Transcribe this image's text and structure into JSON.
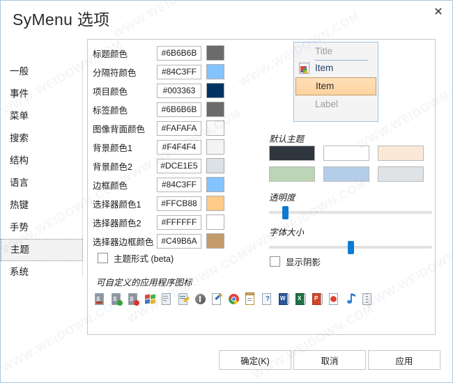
{
  "window": {
    "title": "SyMenu 选项",
    "close_icon": "close-icon"
  },
  "sidebar": {
    "items": [
      {
        "label": "一般",
        "selected": false
      },
      {
        "label": "事件",
        "selected": false
      },
      {
        "label": "菜单",
        "selected": false
      },
      {
        "label": "搜索",
        "selected": false
      },
      {
        "label": "结构",
        "selected": false
      },
      {
        "label": "语言",
        "selected": false
      },
      {
        "label": "热键",
        "selected": false
      },
      {
        "label": "手势",
        "selected": false
      },
      {
        "label": "主题",
        "selected": true
      },
      {
        "label": "系统",
        "selected": false
      }
    ]
  },
  "colors": {
    "rows": [
      {
        "label": "标题颜色",
        "value": "#6B6B6B",
        "swatch": "#6B6B6B"
      },
      {
        "label": "分隔符颜色",
        "value": "#84C3FF",
        "swatch": "#84C3FF"
      },
      {
        "label": "项目颜色",
        "value": "#003363",
        "swatch": "#003363"
      },
      {
        "label": "标签颜色",
        "value": "#6B6B6B",
        "swatch": "#6B6B6B"
      },
      {
        "label": "图像背面颜色",
        "value": "#FAFAFA",
        "swatch": "#FAFAFA"
      },
      {
        "label": "背景颜色1",
        "value": "#F4F4F4",
        "swatch": "#F4F4F4"
      },
      {
        "label": "背景颜色2",
        "value": "#DCE1E5",
        "swatch": "#DCE1E5"
      },
      {
        "label": "边框颜色",
        "value": "#84C3FF",
        "swatch": "#84C3FF"
      },
      {
        "label": "选择器颜色1",
        "value": "#FFCB88",
        "swatch": "#FFCB88"
      },
      {
        "label": "选择器颜色2",
        "value": "#FFFFFF",
        "swatch": "#FFFFFF"
      },
      {
        "label": "选择器边框颜色",
        "value": "#C49B6A",
        "swatch": "#C49B6A"
      }
    ]
  },
  "preview": {
    "title": "Title",
    "item1": "Item",
    "item2": "Item",
    "label": "Label"
  },
  "theme": {
    "heading": "默认主题",
    "swatches": [
      "#2F3640",
      "#FFFFFF",
      "#FBE9D7",
      "#BCD5B6",
      "#B4CDE8",
      "#DFE3E6"
    ]
  },
  "sliders": {
    "transparency": {
      "label": "透明度",
      "value": 10
    },
    "font_size": {
      "label": "字体大小",
      "value": 50
    }
  },
  "checkboxes": {
    "theme_form": {
      "label": "主题形式 (beta)",
      "checked": false
    },
    "show_shadow": {
      "label": "显示阴影",
      "checked": false
    }
  },
  "app_icons": {
    "label": "可自定义的应用程序图标",
    "items": [
      "symenu-icon",
      "symenu-green-icon",
      "symenu-red-icon",
      "windows-xp-icon",
      "document-clock-icon",
      "settings-pencil-icon",
      "info-circle-icon",
      "edit-document-icon",
      "chrome-icon",
      "notepad-icon",
      "help-document-icon",
      "word-icon",
      "excel-icon",
      "powerpoint-icon",
      "pdf-icon",
      "music-note-icon",
      "archive-icon"
    ]
  },
  "buttons": {
    "ok": "确定(K)",
    "cancel": "取消",
    "apply": "应用"
  },
  "watermark": {
    "text": "WWW.WEIDOWN.COM"
  }
}
